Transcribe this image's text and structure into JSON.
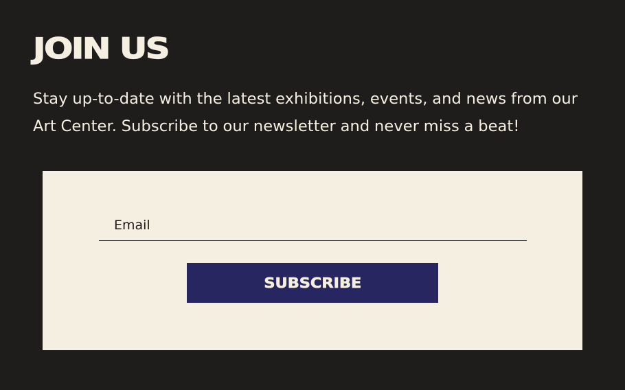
{
  "section": {
    "title": "JOIN US",
    "description": "Stay up-to-date with the latest exhibitions, events, and news from our Art Center. Subscribe to our newsletter and never miss a beat!"
  },
  "form": {
    "email_placeholder": "Email",
    "email_value": "",
    "subscribe_label": "SUBSCRIBE"
  },
  "colors": {
    "background": "#1e1d1b",
    "text_light": "#f5efe2",
    "card_background": "#f5efe2",
    "button_background": "#272660"
  }
}
